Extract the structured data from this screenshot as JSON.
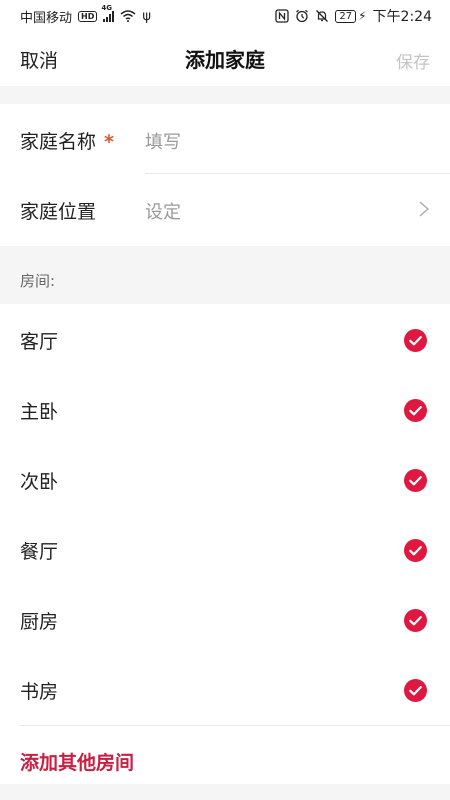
{
  "status_bar": {
    "carrier": "中国移动",
    "hd": "HD",
    "network": "4G",
    "battery": "27",
    "time": "下午2:24"
  },
  "nav": {
    "cancel": "取消",
    "title": "添加家庭",
    "save": "保存"
  },
  "form": {
    "name_label": "家庭名称",
    "required_mark": "*",
    "name_placeholder": "填写",
    "location_label": "家庭位置",
    "location_value": "设定"
  },
  "rooms": {
    "header": "房间:",
    "items": [
      {
        "label": "客厅",
        "checked": true
      },
      {
        "label": "主卧",
        "checked": true
      },
      {
        "label": "次卧",
        "checked": true
      },
      {
        "label": "餐厅",
        "checked": true
      },
      {
        "label": "厨房",
        "checked": true
      },
      {
        "label": "书房",
        "checked": true
      }
    ],
    "add_other": "添加其他房间"
  },
  "colors": {
    "accent": "#c81f43",
    "check": "#e0173f",
    "required": "#e2542b",
    "disabled_text": "#c4c4c4",
    "background_gray": "#f5f5f5"
  }
}
